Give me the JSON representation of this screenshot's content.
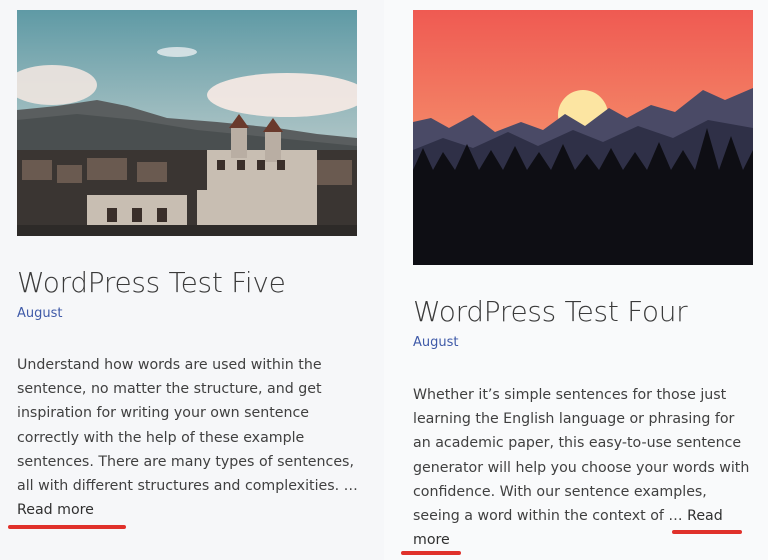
{
  "posts": [
    {
      "title": "WordPress Test Five",
      "date": "August",
      "excerpt": "Understand how words are used within the sentence, no matter the structure, and get inspiration for writing your own sentence correctly with the help of these example sentences. There are many types of sentences, all with different structures and complexities. …",
      "read_more": "Read more"
    },
    {
      "title": "WordPress Test Four",
      "date": "August",
      "excerpt": "Whether it’s simple sentences for those just learning the English language or phrasing for an academic paper, this easy-to-use sentence generator will help you choose your words with confidence. With our sentence examples, seeing a word within the context of …",
      "read_more": "Read more"
    }
  ],
  "colors": {
    "accent_underline": "#e0312b",
    "link": "#3f5aa8",
    "text": "#404040"
  }
}
